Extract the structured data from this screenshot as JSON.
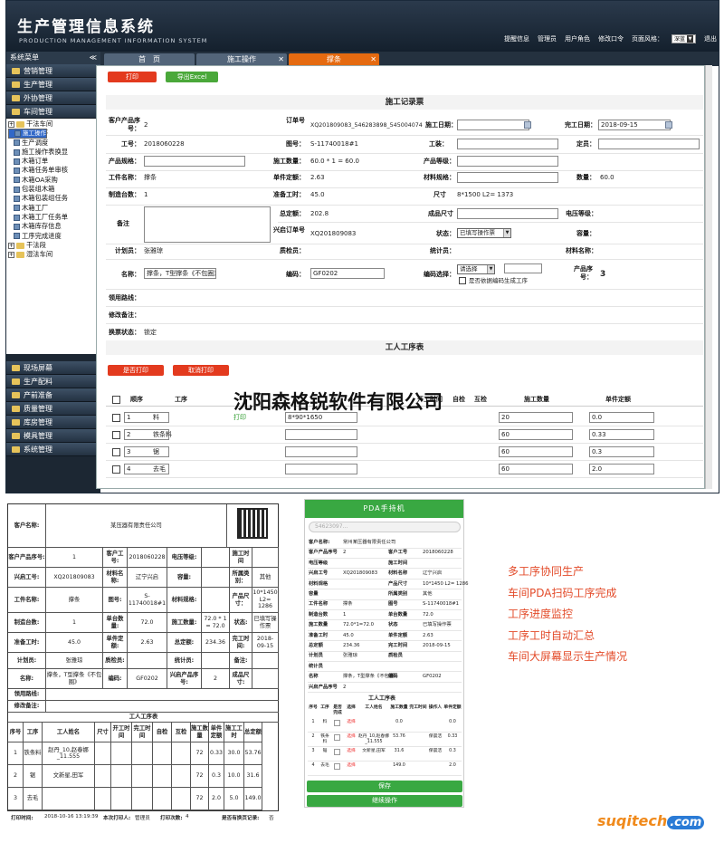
{
  "header": {
    "title": "生产管理信息系统",
    "subtitle": "PRODUCTION MANAGEMENT INFORMATION SYSTEM",
    "nav": [
      "提醒信息",
      "管理员",
      "用户角色",
      "修改口令",
      "页面风格："
    ],
    "style_value": "深蓝",
    "exit": "退出"
  },
  "sidebar": {
    "title": "系统菜单",
    "collapse": "≪",
    "top_menus": [
      "营销管理",
      "生产管理",
      "外协管理",
      "车间管理"
    ],
    "tree": [
      {
        "label": "干法车间",
        "level": 0,
        "kind": "folder"
      },
      {
        "label": "施工操作",
        "level": 1,
        "kind": "page",
        "selected": true
      },
      {
        "label": "工人工序",
        "level": 1,
        "kind": "page"
      },
      {
        "label": "生产调度",
        "level": 1,
        "kind": "page"
      },
      {
        "label": "施工操作表换显",
        "level": 1,
        "kind": "page"
      },
      {
        "label": "木箱订单",
        "level": 1,
        "kind": "page"
      },
      {
        "label": "木箱任务单审核",
        "level": 1,
        "kind": "page"
      },
      {
        "label": "木箱OA采购",
        "level": 1,
        "kind": "page"
      },
      {
        "label": "包装组木箱",
        "level": 1,
        "kind": "page"
      },
      {
        "label": "木箱包装组任务",
        "level": 1,
        "kind": "page"
      },
      {
        "label": "木箱工厂",
        "level": 1,
        "kind": "page"
      },
      {
        "label": "木箱工厂任务单",
        "level": 1,
        "kind": "page"
      },
      {
        "label": "木箱库存信息",
        "level": 1,
        "kind": "page"
      },
      {
        "label": "工序完成进度",
        "level": 1,
        "kind": "page"
      },
      {
        "label": "干法段",
        "level": 0,
        "kind": "folder"
      },
      {
        "label": "湿法车间",
        "level": 0,
        "kind": "folder"
      }
    ],
    "bottom_menus": [
      "现场屏幕",
      "生产配料",
      "产前准备",
      "质量管理",
      "库房管理",
      "模具管理",
      "系统管理"
    ]
  },
  "tabs": [
    "首　页",
    "施工操作",
    "撑条"
  ],
  "toolbar": {
    "print": "打印",
    "export": "导出Excel"
  },
  "form": {
    "title": "施工记录票",
    "customer_product_no_label": "客户产品序号：",
    "customer_product_no": "2",
    "order_no_label": "订单号",
    "order_no": "XQ201809083_546283898_545004074",
    "start_date_label": "施工日期：",
    "finish_date_label": "完工日期：",
    "finish_date": "2018-09-15",
    "work_no_label": "工号：",
    "work_no": "2018060228",
    "drawing_no_label": "图号：",
    "drawing_no": "S-11740018#1",
    "worker_label": "工装：",
    "quota_label": "定员：",
    "spec_label": "产品规格：",
    "qty_label": "施工数量：",
    "qty": "60.0 * 1 = 60.0",
    "grade_label": "产品等级：",
    "part_label": "工件名称：",
    "part": "撑条",
    "unit_quota_label": "单件定额：",
    "unit_quota": "2.63",
    "material_label": "材料规格：",
    "count_label": "数量：",
    "count": "60.0",
    "make_count_label": "制造台数：",
    "make_count": "1",
    "prep_time_label": "准备工时：",
    "prep_time": "45.0",
    "size_label": "尺寸",
    "size": "8*1500 L2= 1373",
    "remark_label": "备注",
    "total_quota_label": "总定额：",
    "total_quota": "202.8",
    "product_size_label": "成品尺寸",
    "voltage_label": "电压等级：",
    "xing_order_label": "兴启订单号",
    "xing_order": "XQ201809083",
    "status_label": "状态：",
    "status_value": "已填写操作票",
    "capacity_label": "容量：",
    "planner_label": "计划员：",
    "planner": "张雅琼",
    "inspector_label": "质检员：",
    "statistician_label": "统计员：",
    "material_name_label": "材料名称：",
    "name_label": "名称：",
    "name_value": "撑条，T型撑条《不包圈》",
    "code_label": "编码：",
    "code_value": "GF0202",
    "code_select_label": "编码选择：",
    "code_select_value": "请选择",
    "code_checkbox_label": "是否依据编码生成工序",
    "product_seq_label": "产品序号：",
    "product_seq": "3",
    "route_label": "领用路线：",
    "modify_note_label": "修改备注：",
    "page_status_label": "换票状态：",
    "page_status": "锁定"
  },
  "worker_table": {
    "title": "工人工序表",
    "btn_print": "是否打印",
    "btn_cancel": "取消打印",
    "headers": [
      "",
      "顺序",
      "工序",
      "",
      "",
      "",
      "",
      "",
      "开工时间",
      "自检",
      "互检",
      "施工数量",
      "单件定额"
    ],
    "rows": [
      {
        "seq": "1",
        "proc": "料",
        "print": "打印",
        "size": "8*90*1650",
        "qty": "20",
        "unit": "0.0"
      },
      {
        "seq": "2",
        "proc": "铁条料",
        "print": "",
        "size": "",
        "qty": "60",
        "unit": "0.33"
      },
      {
        "seq": "3",
        "proc": "锯",
        "print": "",
        "size": "",
        "qty": "60",
        "unit": "0.3"
      },
      {
        "seq": "4",
        "proc": "去毛",
        "print": "",
        "size": "",
        "qty": "60",
        "unit": "2.0"
      }
    ]
  },
  "watermark": "沈阳森格锐软件有限公司",
  "sheet": {
    "customer_label": "客户名称:",
    "customer": "某压器有限责任公司",
    "rows": [
      [
        "客户产品序号:",
        "1",
        "客户工号:",
        "2018060228",
        "电压等级:",
        "",
        "施工时间",
        ""
      ],
      [
        "兴启工号:",
        "XQ201809083",
        "材料名称:",
        "辽宁兴启",
        "容量:",
        "",
        "所属类别：",
        "其他"
      ],
      [
        "工件名称:",
        "撑条",
        "图号:",
        "S-11740018#1",
        "材料规格:",
        "",
        "产品尺寸：",
        "10*1450 L2= 1286"
      ],
      [
        "制造台数:",
        "1",
        "单台数量:",
        "72.0",
        "施工数量:",
        "72.0 * 1 = 72.0",
        "状态:",
        "已填写操作票"
      ],
      [
        "准备工时:",
        "45.0",
        "单件定额:",
        "2.63",
        "总定额:",
        "234.36",
        "完工时间:",
        "2018-09-15"
      ],
      [
        "计划员:",
        "张雅琼",
        "质检员:",
        "",
        "统计员:",
        "",
        "备注:",
        ""
      ],
      [
        "名称:",
        "撑条，T型撑条《不包圈》",
        "编码:",
        "GF0202",
        "兴启产品序号:",
        "2",
        "成品尺寸:",
        ""
      ]
    ],
    "route_label": "领用路线:",
    "modify_label": "修改备注:",
    "table_title": "工人工序表",
    "table_headers": [
      "序号",
      "工序",
      "工人姓名",
      "尺寸",
      "开工时间",
      "完工时间",
      "自检",
      "互检",
      "施工数量",
      "单件定额",
      "施工工时",
      "总定额"
    ],
    "table_rows": [
      [
        "1",
        "铁条料",
        "赵丹_10,赵春娜_11.555",
        "",
        "",
        "",
        "",
        "",
        "72",
        "0.33",
        "30.0",
        "53.76"
      ],
      [
        "2",
        "锯",
        "文新星,田军",
        "",
        "",
        "",
        "",
        "",
        "72",
        "0.3",
        "10.0",
        "31.6"
      ],
      [
        "3",
        "去毛",
        "",
        "",
        "",
        "",
        "",
        "",
        "72",
        "2.0",
        "5.0",
        "149.0"
      ]
    ],
    "footer": [
      "打印时间:",
      "2018-10-16 13:19:39",
      "本次打印人:",
      "管理员",
      "打印次数:",
      "4",
      "是否有换页记录:",
      "否"
    ]
  },
  "pda": {
    "title": "PDA手持机",
    "search": "54623097...",
    "fields": [
      [
        "客户名称:",
        "常州某压器有限责任公司",
        "",
        ""
      ],
      [
        "客户产品序号",
        "2",
        "客户工号",
        "2018060228"
      ],
      [
        "电压等级",
        "",
        "施工时间",
        ""
      ],
      [
        "兴启工号",
        "XQ201809083",
        "材料名称",
        "辽宁兴启"
      ],
      [
        "材料规格",
        "",
        "产品尺寸",
        "10*1450 L2= 1286"
      ],
      [
        "容量",
        "",
        "所属类别",
        "其他"
      ],
      [
        "工件名称",
        "撑条",
        "图号",
        "S-11740018#1"
      ],
      [
        "制造台数",
        "1",
        "单台数量",
        "72.0"
      ],
      [
        "施工数量",
        "72.0*1=72.0",
        "状态",
        "已填写操作票"
      ],
      [
        "准备工时",
        "45.0",
        "单件定额",
        "2.63"
      ],
      [
        "总定额",
        "234.36",
        "完工时间",
        "2018-09-15"
      ],
      [
        "计划员",
        "张雅琼",
        "质检员",
        ""
      ],
      [
        "统计员",
        "",
        "",
        ""
      ],
      [
        "名称",
        "撑条，T型撑条《不包圈》",
        "编码",
        "GF0202"
      ],
      [
        "兴启产品序号",
        "2",
        "",
        ""
      ]
    ],
    "table_title": "工人工序表",
    "table_headers": [
      "序号",
      "工序",
      "是否完成",
      "选择",
      "工人姓名",
      "施工数量",
      "完工时间",
      "操作人",
      "单件定额"
    ],
    "table_rows": [
      [
        "1",
        "料",
        "",
        "选择",
        "",
        "0.0",
        "",
        "",
        "0.0"
      ],
      [
        "2",
        "铁条料",
        "",
        "选择",
        "赵丹_10,赵春娜_11.555",
        "53.76",
        "",
        "保晨洁",
        "0.33"
      ],
      [
        "3",
        "锯",
        "",
        "选择",
        "文新星,田军",
        "31.6",
        "",
        "保晨洁",
        "0.3"
      ],
      [
        "4",
        "去毛",
        "",
        "选择",
        "",
        "149.0",
        "",
        "",
        "2.0"
      ]
    ],
    "save": "保存",
    "continue": "继续操作"
  },
  "features": [
    "多工序协同生产",
    "车间PDA扫码工序完成",
    "工序进度监控",
    "工序工时自动汇总",
    "车间大屏幕显示生产情况"
  ],
  "logo": {
    "part1": "suqitech",
    "part2": ".com"
  }
}
